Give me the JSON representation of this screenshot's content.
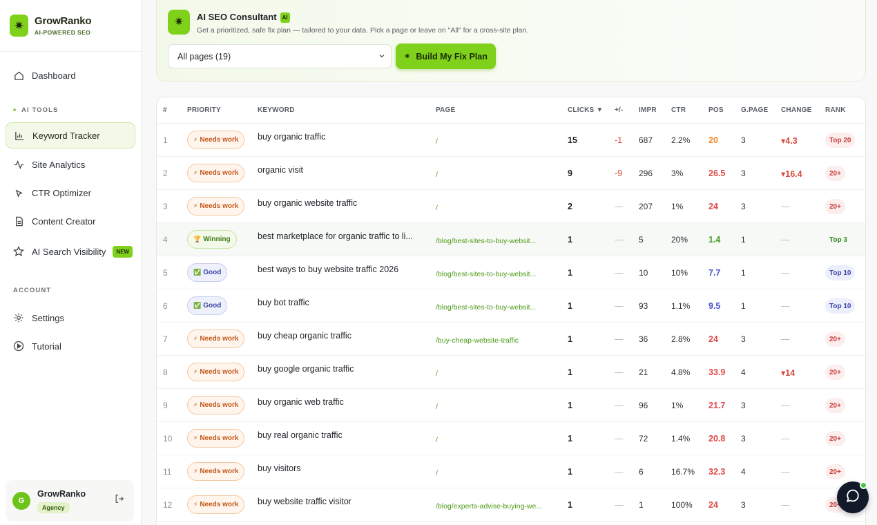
{
  "brand": {
    "name": "GrowRanko",
    "tagline": "AI-POWERED SEO"
  },
  "nav": {
    "dashboard": "Dashboard",
    "section_ai": "AI TOOLS",
    "keyword_tracker": "Keyword Tracker",
    "site_analytics": "Site Analytics",
    "ctr_optimizer": "CTR Optimizer",
    "content_creator": "Content Creator",
    "ai_visibility": "AI Search Visibility",
    "new_badge": "NEW",
    "section_account": "ACCOUNT",
    "settings": "Settings",
    "tutorial": "Tutorial"
  },
  "user": {
    "initial": "G",
    "name": "GrowRanko",
    "plan": "Agency"
  },
  "consultant": {
    "title": "AI SEO Consultant",
    "ai_tag": "AI",
    "subtitle": "Get a prioritized, safe fix plan — tailored to your data. Pick a page or leave on \"All\" for a cross-site plan.",
    "select_value": "All pages (19)",
    "button_label": "Build My Fix Plan"
  },
  "table": {
    "headers": [
      "#",
      "PRIORITY",
      "KEYWORD",
      "PAGE",
      "CLICKS ▼",
      "+/-",
      "IMPR",
      "CTR",
      "POS",
      "G.PAGE",
      "CHANGE",
      "RANK"
    ],
    "rows": [
      {
        "n": "1",
        "prio": "Needs work",
        "kw": "buy organic traffic",
        "page": "/",
        "clicks": "15",
        "delta": "-1",
        "impr": "687",
        "ctr": "2.2%",
        "pos": "20",
        "gpage": "3",
        "change": "▾4.3",
        "rank": "Top 20"
      },
      {
        "n": "2",
        "prio": "Needs work",
        "kw": "organic visit",
        "page": "/",
        "clicks": "9",
        "delta": "-9",
        "impr": "296",
        "ctr": "3%",
        "pos": "26.5",
        "gpage": "3",
        "change": "▾16.4",
        "rank": "20+"
      },
      {
        "n": "3",
        "prio": "Needs work",
        "kw": "buy organic website traffic",
        "page": "/",
        "clicks": "2",
        "delta": "—",
        "impr": "207",
        "ctr": "1%",
        "pos": "24",
        "gpage": "3",
        "change": "—",
        "rank": "20+"
      },
      {
        "n": "4",
        "prio": "Winning",
        "kw": "best marketplace for organic traffic to li...",
        "page": "/blog/best-sites-to-buy-websit...",
        "clicks": "1",
        "delta": "—",
        "impr": "5",
        "ctr": "20%",
        "pos": "1.4",
        "gpage": "1",
        "change": "—",
        "rank": "Top 3"
      },
      {
        "n": "5",
        "prio": "Good",
        "kw": "best ways to buy website traffic 2026",
        "page": "/blog/best-sites-to-buy-websit...",
        "clicks": "1",
        "delta": "—",
        "impr": "10",
        "ctr": "10%",
        "pos": "7.7",
        "gpage": "1",
        "change": "—",
        "rank": "Top 10"
      },
      {
        "n": "6",
        "prio": "Good",
        "kw": "buy bot traffic",
        "page": "/blog/best-sites-to-buy-websit...",
        "clicks": "1",
        "delta": "—",
        "impr": "93",
        "ctr": "1.1%",
        "pos": "9.5",
        "gpage": "1",
        "change": "—",
        "rank": "Top 10"
      },
      {
        "n": "7",
        "prio": "Needs work",
        "kw": "buy cheap organic traffic",
        "page": "/buy-cheap-website-traffic",
        "clicks": "1",
        "delta": "—",
        "impr": "36",
        "ctr": "2.8%",
        "pos": "24",
        "gpage": "3",
        "change": "—",
        "rank": "20+"
      },
      {
        "n": "8",
        "prio": "Needs work",
        "kw": "buy google organic traffic",
        "page": "/",
        "clicks": "1",
        "delta": "—",
        "impr": "21",
        "ctr": "4.8%",
        "pos": "33.9",
        "gpage": "4",
        "change": "▾14",
        "rank": "20+"
      },
      {
        "n": "9",
        "prio": "Needs work",
        "kw": "buy organic web traffic",
        "page": "/",
        "clicks": "1",
        "delta": "—",
        "impr": "96",
        "ctr": "1%",
        "pos": "21.7",
        "gpage": "3",
        "change": "—",
        "rank": "20+"
      },
      {
        "n": "10",
        "prio": "Needs work",
        "kw": "buy real organic traffic",
        "page": "/",
        "clicks": "1",
        "delta": "—",
        "impr": "72",
        "ctr": "1.4%",
        "pos": "20.8",
        "gpage": "3",
        "change": "—",
        "rank": "20+"
      },
      {
        "n": "11",
        "prio": "Needs work",
        "kw": "buy visitors",
        "page": "/",
        "clicks": "1",
        "delta": "—",
        "impr": "6",
        "ctr": "16.7%",
        "pos": "32.3",
        "gpage": "4",
        "change": "—",
        "rank": "20+"
      },
      {
        "n": "12",
        "prio": "Needs work",
        "kw": "buy website traffic visitor",
        "page": "/blog/experts-advise-buying-we...",
        "clicks": "1",
        "delta": "—",
        "impr": "1",
        "ctr": "100%",
        "pos": "24",
        "gpage": "3",
        "change": "—",
        "rank": "20+"
      }
    ]
  },
  "colors": {
    "accent": "#7fd11b",
    "chat_bg": "#121a2a",
    "online": "#3fca43"
  }
}
